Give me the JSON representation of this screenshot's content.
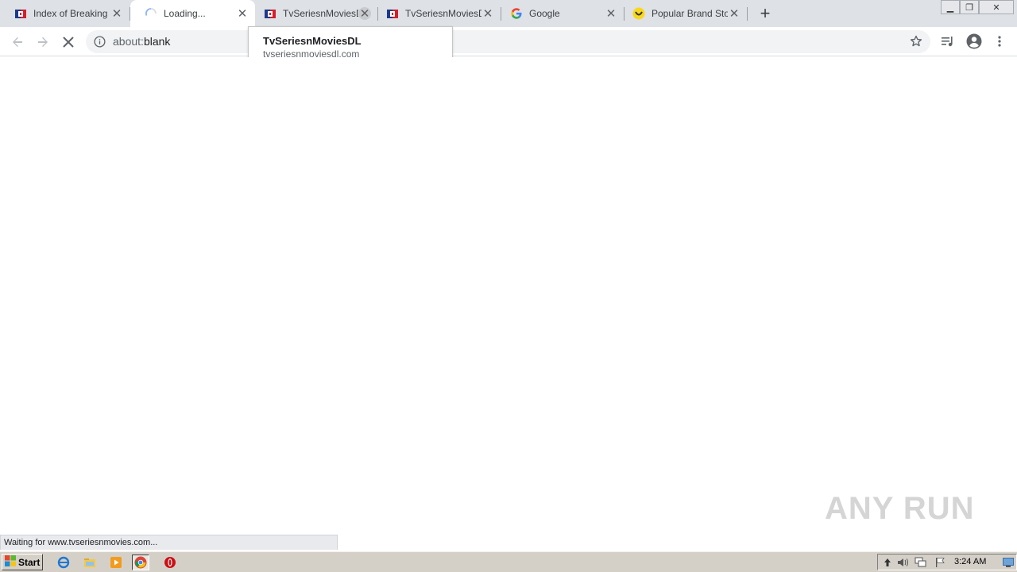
{
  "tabs": [
    {
      "title": "Index of Breaking B",
      "favicon": "tv-flag-icon",
      "state": "normal"
    },
    {
      "title": "Loading...",
      "favicon": "loading-spinner-icon",
      "state": "active"
    },
    {
      "title": "TvSeriesnMoviesDL",
      "favicon": "tv-flag-icon",
      "state": "close-hover"
    },
    {
      "title": "TvSeriesnMoviesDL",
      "favicon": "tv-flag-icon",
      "state": "normal"
    },
    {
      "title": "Google",
      "favicon": "google-g-icon",
      "state": "normal"
    },
    {
      "title": "Popular Brand Stor",
      "favicon": "smiley-icon",
      "state": "normal"
    }
  ],
  "new_tab_symbol": "+",
  "window_controls": {
    "minimize": "▁",
    "restore": "❐",
    "close": "✕"
  },
  "toolbar": {
    "url_prefix": "about:",
    "url_rest": "blank"
  },
  "tooltip": {
    "title": "TvSeriesnMoviesDL",
    "url": "tvseriesnmoviesdl.com"
  },
  "status_text": "Waiting for www.tvseriesnmovies.com...",
  "watermark": "ANY RUN",
  "taskbar": {
    "start_label": "Start",
    "clock": "3:24 AM"
  },
  "colors": {
    "tab_strip": "#dee1e6",
    "active_tab": "#ffffff",
    "omnibox": "#f1f3f4",
    "taskbar": "#d4d0c8"
  }
}
